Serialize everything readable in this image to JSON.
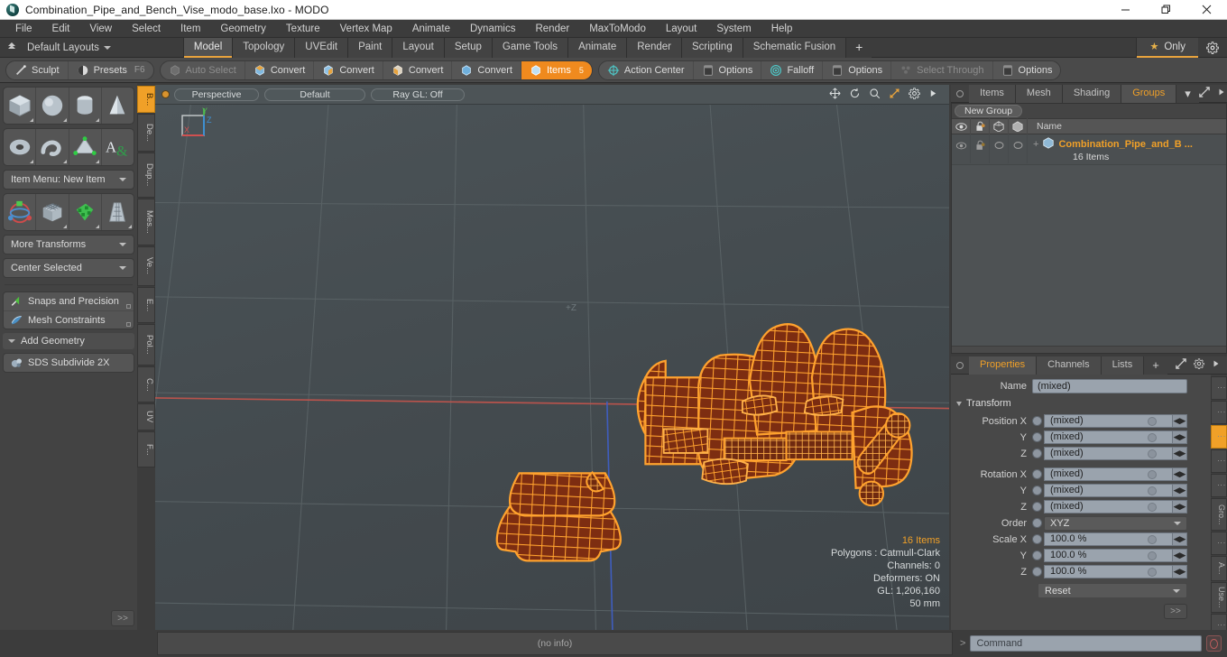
{
  "window": {
    "title": "Combination_Pipe_and_Bench_Vise_modo_base.lxo - MODO",
    "minimize": "minimize-button",
    "maximize": "restore-button",
    "close": "close-button"
  },
  "menubar": {
    "items": [
      "File",
      "Edit",
      "View",
      "Select",
      "Item",
      "Geometry",
      "Texture",
      "Vertex Map",
      "Animate",
      "Dynamics",
      "Render",
      "MaxToModo",
      "Layout",
      "System",
      "Help"
    ]
  },
  "layoutbar": {
    "layouts_label": "Default Layouts",
    "tabs": [
      "Model",
      "Topology",
      "UVEdit",
      "Paint",
      "Layout",
      "Setup",
      "Game Tools",
      "Animate",
      "Render",
      "Scripting",
      "Schematic Fusion"
    ],
    "active_tab": "Model",
    "add_label": "+",
    "only_label": "Only",
    "star_glyph": "★"
  },
  "toolstrip": {
    "group1": [
      {
        "label": "Sculpt",
        "icon": "sculpt-icon",
        "state": "normal"
      },
      {
        "label": "Presets",
        "icon": "presets-icon",
        "shortcut": "F6",
        "state": "normal"
      }
    ],
    "group2": [
      {
        "label": "Auto Select",
        "icon": "auto-select-icon",
        "state": "dim"
      },
      {
        "label": "Convert",
        "icon": "convert-vertex-icon",
        "state": "normal"
      },
      {
        "label": "Convert",
        "icon": "convert-edge-icon",
        "state": "normal"
      },
      {
        "label": "Convert",
        "icon": "convert-polygon-icon",
        "state": "normal"
      },
      {
        "label": "Convert",
        "icon": "convert-material-icon",
        "state": "normal"
      },
      {
        "label": "Items",
        "icon": "items-icon",
        "state": "active",
        "badge": "5"
      }
    ],
    "group3": [
      {
        "label": "Action Center",
        "icon": "action-center-icon",
        "state": "normal"
      },
      {
        "label": "Options",
        "icon": "options-icon",
        "state": "normal"
      },
      {
        "label": "Falloff",
        "icon": "falloff-icon",
        "state": "normal"
      },
      {
        "label": "Options",
        "icon": "options-icon",
        "state": "normal"
      },
      {
        "label": "Select Through",
        "icon": "select-through-icon",
        "state": "dim"
      },
      {
        "label": "Options",
        "icon": "options-icon",
        "state": "normal"
      }
    ]
  },
  "leftpanel": {
    "primitives_row1": [
      "cube-icon",
      "sphere-icon",
      "cylinder-icon",
      "cone-icon"
    ],
    "primitives_row2": [
      "torus-icon",
      "tube-icon",
      "prism-icon",
      "text-icon"
    ],
    "item_menu": "Item Menu: New Item",
    "tools_row": [
      "transform-gizmo-icon",
      "grid-mesh-icon",
      "paint-mesh-icon",
      "taper-mesh-icon"
    ],
    "more_transforms": "More Transforms",
    "center_selected": "Center Selected",
    "snaps": "Snaps and Precision",
    "mesh_constraints": "Mesh Constraints",
    "add_geometry": "Add Geometry",
    "sds_subdivide": "SDS Subdivide 2X",
    "forward": ">>"
  },
  "vstrip": {
    "tabs": [
      "B...",
      "De...",
      "Dup...",
      "Mes...",
      "Ve...",
      "E...",
      "Pol...",
      "C...",
      "UV",
      "F..."
    ],
    "active_index": 0
  },
  "viewport": {
    "view_mode": "Perspective",
    "shading": "Default",
    "raygl": "Ray GL: Off",
    "axis_label": "+Z",
    "header_icons": [
      "move-view-icon",
      "rotate-view-icon",
      "zoom-view-icon",
      "fit-view-icon",
      "viewport-gear-icon",
      "viewport-more-icon"
    ],
    "gizmo_axes": [
      "X",
      "Y",
      "Z"
    ],
    "stats": {
      "items": "16 Items",
      "polygons": "Polygons : Catmull-Clark",
      "channels": "Channels: 0",
      "deformers": "Deformers: ON",
      "gl": "GL: 1,206,160",
      "scale": "50 mm"
    },
    "status": "(no info)",
    "colors": {
      "background": "#454d50",
      "wireframe": "#ffa02e",
      "fill": "#7a2d14",
      "x_axis": "#c85a52",
      "z_axis": "#4060c8"
    }
  },
  "rightpanel": {
    "top_tabs": [
      "Items",
      "Mesh ...",
      "Shading",
      "Groups"
    ],
    "top_active": "Groups",
    "top_plus": "▾",
    "new_group_label": "New Group",
    "list_columns": [
      "visibility-icon",
      "lock-icon",
      "wireframe-icon",
      "shaded-icon",
      "Name"
    ],
    "rows": [
      {
        "name": "Combination_Pipe_and_B ...",
        "subtitle": "16 Items",
        "expander": "+"
      }
    ],
    "bottom_tabs": [
      "Properties",
      "Channels",
      "Lists"
    ],
    "bottom_active": "Properties",
    "bottom_plus": "+",
    "properties": {
      "name_label": "Name",
      "name_value": "(mixed)",
      "transform_label": "Transform",
      "rows": [
        {
          "label": "Position X",
          "value": "(mixed)"
        },
        {
          "label": "Y",
          "value": "(mixed)"
        },
        {
          "label": "Z",
          "value": "(mixed)"
        },
        {
          "label": "Rotation X",
          "value": "(mixed)"
        },
        {
          "label": "Y",
          "value": "(mixed)"
        },
        {
          "label": "Z",
          "value": "(mixed)"
        }
      ],
      "order_label": "Order",
      "order_value": "XYZ",
      "scale_rows": [
        {
          "label": "Scale X",
          "value": "100.0 %"
        },
        {
          "label": "Y",
          "value": "100.0 %"
        },
        {
          "label": "Z",
          "value": "100.0 %"
        }
      ],
      "reset_label": "Reset",
      "forward": ">>"
    },
    "side_tabs": [
      "⋮",
      "⋮",
      "⋮",
      "⋮",
      "⋮",
      "Gro...",
      "⋮",
      "A...",
      "Use...",
      "⋮"
    ],
    "side_active_index": 2
  },
  "bottombar": {
    "info": "(no info)",
    "command_placeholder": "Command",
    "prompt": ">",
    "stop_icon": "stop-command-icon"
  }
}
